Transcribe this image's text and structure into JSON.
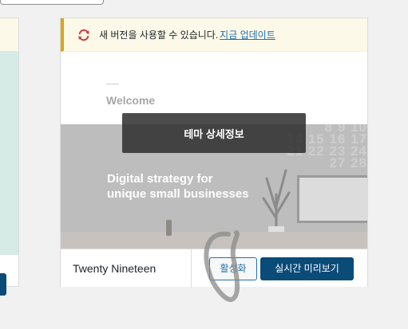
{
  "notice": {
    "icon": "update-icon",
    "text": "새 버전을 사용할 수 있습니다.",
    "link": "지금 업데이트"
  },
  "screenshot": {
    "welcome": "Welcome",
    "hero_line1": "Digital strategy for",
    "hero_line2": "unique small businesses",
    "calendar_numbers": "8 9 10\n14 15 16 17\n21 22 23 24\n27 28"
  },
  "overlay": {
    "label": "테마 상세정보"
  },
  "footer": {
    "theme_name": "Twenty Nineteen",
    "activate_label": "활성화",
    "preview_label": "실시간 미리보기"
  },
  "colors": {
    "notice_border": "#dba617",
    "notice_bg": "#fcf9e8",
    "update_icon": "#d63638",
    "link": "#2271b1",
    "primary_button": "#0a4b78",
    "annotation_stroke": "#8a8a8a"
  }
}
